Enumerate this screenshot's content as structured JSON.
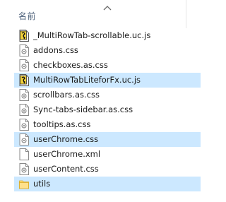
{
  "header": {
    "name_column": "名前"
  },
  "files": [
    {
      "name": "_MultiRowTab-scrollable.uc.js",
      "icon": "js-script-icon",
      "selected": false
    },
    {
      "name": "addons.css",
      "icon": "css-file-icon",
      "selected": false
    },
    {
      "name": "checkboxes.as.css",
      "icon": "css-file-icon",
      "selected": false
    },
    {
      "name": "MultiRowTabLiteforFx.uc.js",
      "icon": "js-script-icon",
      "selected": true
    },
    {
      "name": "scrollbars.as.css",
      "icon": "css-file-icon",
      "selected": false
    },
    {
      "name": "Sync-tabs-sidebar.as.css",
      "icon": "css-file-icon",
      "selected": false
    },
    {
      "name": "tooltips.as.css",
      "icon": "css-file-icon",
      "selected": false
    },
    {
      "name": "userChrome.css",
      "icon": "css-file-icon",
      "selected": true
    },
    {
      "name": "userChrome.xml",
      "icon": "blank-file-icon",
      "selected": false
    },
    {
      "name": "userContent.css",
      "icon": "css-file-icon",
      "selected": false
    },
    {
      "name": "utils",
      "icon": "folder-icon",
      "selected": true
    }
  ],
  "colors": {
    "selection": "#cce8ff",
    "folder": "#ffd96b",
    "header_text": "#4c607a"
  }
}
